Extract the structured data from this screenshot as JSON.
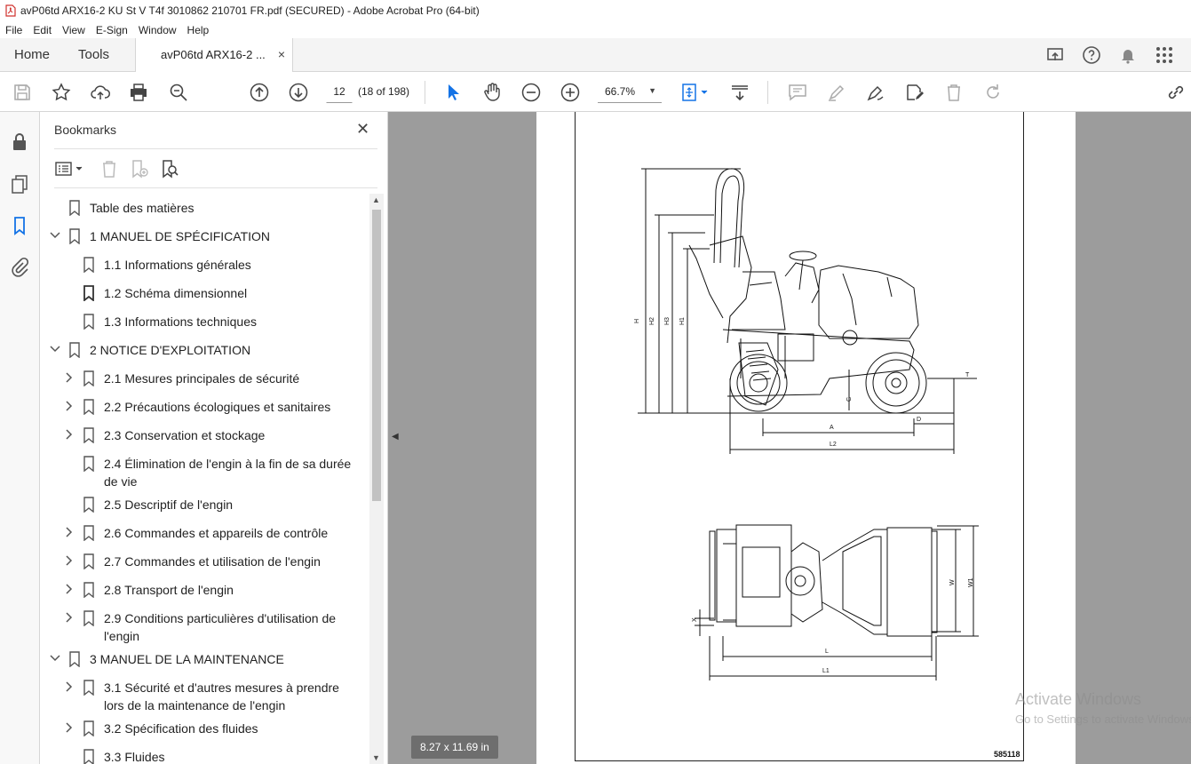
{
  "window": {
    "title": "avP06td ARX16-2 KU St V T4f 3010862 210701 FR.pdf (SECURED) - Adobe Acrobat Pro (64-bit)"
  },
  "menu": [
    "File",
    "Edit",
    "View",
    "E-Sign",
    "Window",
    "Help"
  ],
  "tabs": {
    "home": "Home",
    "tools": "Tools",
    "document": "avP06td ARX16-2 ...",
    "close": "×"
  },
  "toolbar": {
    "page_number": "12",
    "page_count": "(18 of 198)",
    "zoom": "66.7%"
  },
  "bookmarks": {
    "title": "Bookmarks",
    "close": "✕",
    "items": [
      {
        "label": "Table des matières"
      },
      {
        "label": "1 MANUEL DE SPÉCIFICATION"
      },
      {
        "label": "1.1 Informations générales"
      },
      {
        "label": "1.2 Schéma dimensionnel"
      },
      {
        "label": "1.3 Informations techniques"
      },
      {
        "label": "2 NOTICE D'EXPLOITATION"
      },
      {
        "label": "2.1 Mesures principales de sécurité"
      },
      {
        "label": "2.2 Précautions écologiques et sanitaires"
      },
      {
        "label": "2.3 Conservation et stockage"
      },
      {
        "label": "2.4 Élimination de l'engin à la fin de sa durée",
        "label2": "de vie"
      },
      {
        "label": "2.5 Descriptif de l'engin"
      },
      {
        "label": "2.6 Commandes et appareils de contrôle"
      },
      {
        "label": "2.7 Commandes et utilisation de l'engin"
      },
      {
        "label": "2.8 Transport de l'engin"
      },
      {
        "label": "2.9 Conditions particulières d'utilisation de",
        "label2": "l'engin"
      },
      {
        "label": "3 MANUEL DE LA MAINTENANCE"
      },
      {
        "label": "3.1 Sécurité et d'autres mesures à prendre",
        "label2": "lors de la maintenance de l'engin"
      },
      {
        "label": "3.2 Spécification des fluides"
      },
      {
        "label": "3.3 Fluides"
      }
    ]
  },
  "document": {
    "page_size": "8.27 x 11.69 in",
    "page_code": "585118",
    "drawing_labels": {
      "h": "H",
      "h2": "H2",
      "h3": "H3",
      "h1": "H1",
      "a": "A",
      "d": "D",
      "g": "G",
      "t": "T",
      "l2": "L2",
      "l": "L",
      "l1": "L1",
      "w": "W",
      "w1": "W1",
      "x": "X"
    }
  },
  "watermark": {
    "line1": "Activate Windows",
    "line2": "Go to Settings to activate Windows."
  }
}
